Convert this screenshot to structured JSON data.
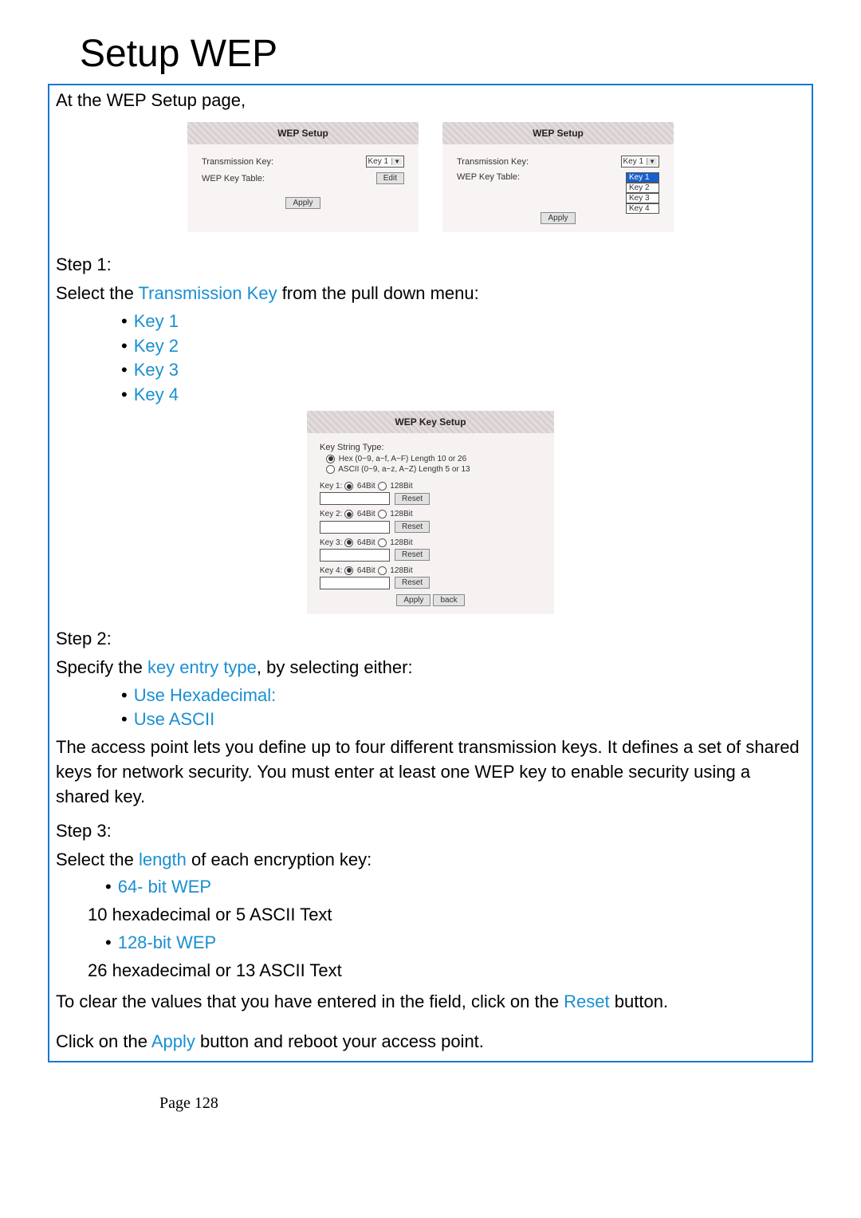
{
  "heading": "Setup WEP",
  "intro": "At the WEP Setup page,",
  "panel1": {
    "title": "WEP Setup",
    "row1_label": "Transmission Key:",
    "row1_value": "Key 1",
    "row2_label": "WEP Key Table:",
    "row2_btn": "Edit",
    "apply": "Apply"
  },
  "panel2": {
    "title": "WEP Setup",
    "row1_label": "Transmission Key:",
    "row1_value": "Key 1",
    "row2_label": "WEP Key Table:",
    "opts": {
      "k1": "Key 1",
      "k2": "Key 2",
      "k3": "Key 3",
      "k4": "Key 4"
    },
    "apply": "Apply"
  },
  "step1": {
    "label": "Step 1:",
    "text_pre": "Select the ",
    "text_hi": "Transmission Key",
    "text_post": " from the pull down menu:",
    "keys": {
      "k1": "Key 1",
      "k2": "Key 2",
      "k3": "Key 3",
      "k4": "Key 4"
    }
  },
  "wep_key_setup": {
    "title": "WEP Key Setup",
    "kst": "Key String Type:",
    "opt1": "Hex (0~9, a~f, A~F) Length 10 or 26",
    "opt2": "ASCII (0~9, a~z, A~Z) Length 5 or 13",
    "keys": {
      "k1": "Key 1:",
      "k2": "Key 2:",
      "k3": "Key 3:",
      "k4": "Key 4:"
    },
    "bit64": "64Bit",
    "bit128": "128Bit",
    "reset": "Reset",
    "apply": "Apply",
    "back": "back"
  },
  "step2": {
    "label": "Step 2:",
    "line1_pre": "Specify the ",
    "line1_hi": "key entry type",
    "line1_post": ", by selecting either:",
    "b1": "Use Hexadecimal:",
    "b2": "Use ASCII",
    "para": "The access point lets you define up to four different transmission keys. It defines a set of shared keys for network security. You must enter at least one WEP key to enable security using a shared key."
  },
  "step3": {
    "label": "Step 3:",
    "line1_pre": "Select the ",
    "line1_hi": "length",
    "line1_post": " of each encryption key:",
    "b1": "64- bit WEP",
    "b1_sub": "10 hexadecimal or 5 ASCII Text",
    "b2": "128-bit WEP",
    "b2_sub": "26 hexadecimal or 13 ASCII Text",
    "clear_pre": "To clear the values that you have entered in the field, click on the ",
    "clear_hi": "Reset",
    "clear_post": " button.",
    "final_pre": "Click on the ",
    "final_hi": "Apply",
    "final_post": " button and reboot your access point."
  },
  "footer": "Page 128"
}
